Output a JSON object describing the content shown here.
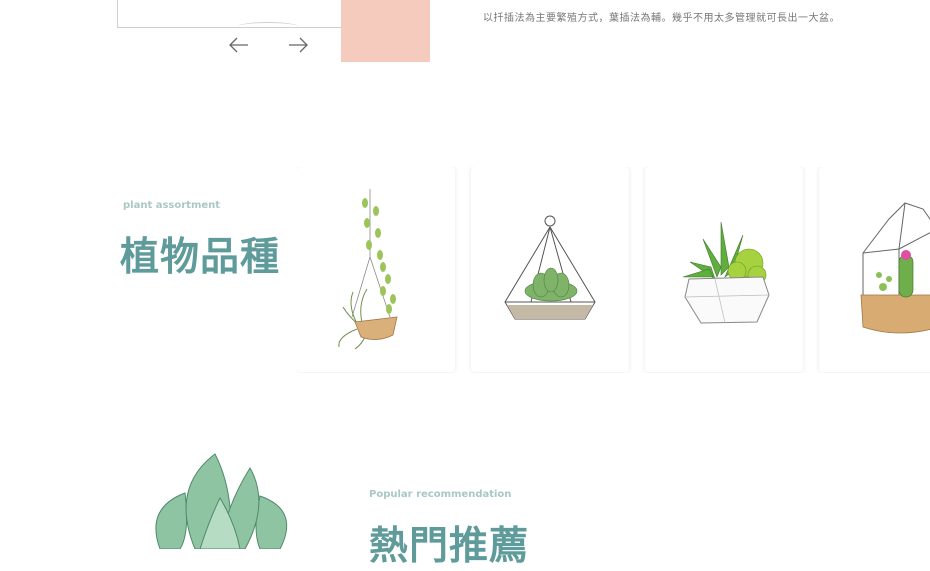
{
  "top": {
    "description": "以扦插法為主要繁殖方式，葉插法為輔。幾乎不用太多管理就可長出一大盆。",
    "prev_icon": "arrow-left-icon",
    "next_icon": "arrow-right-icon"
  },
  "plant_assortment": {
    "subtitle": "plant assortment",
    "title": "植物品種",
    "cards": [
      {
        "icon": "hanging-air-plant-icon"
      },
      {
        "icon": "hanging-terrarium-succulent-icon"
      },
      {
        "icon": "potted-aloe-succulent-icon"
      },
      {
        "icon": "glass-terrarium-cactus-icon"
      }
    ]
  },
  "popular": {
    "subtitle": "Popular recommendation",
    "title": "熱門推薦",
    "image_icon": "succulent-rosette-icon"
  },
  "colors": {
    "accent_teal": "#5f9b9a",
    "subtitle_teal": "#a9c7c5",
    "pink_block": "#f5cbbd"
  }
}
